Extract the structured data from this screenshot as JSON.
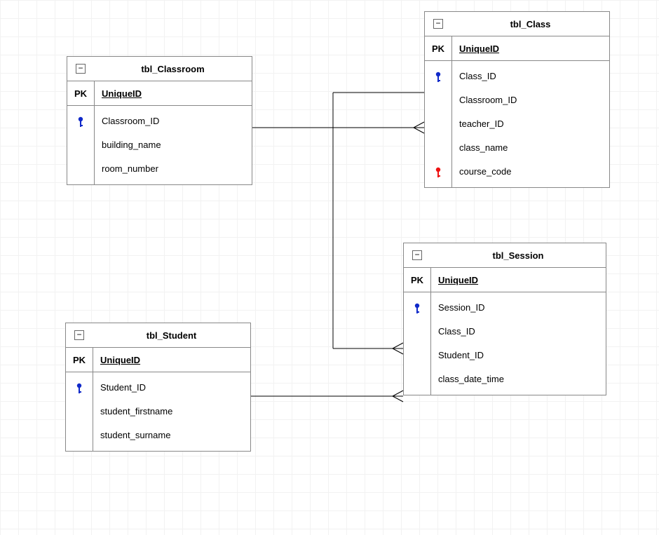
{
  "pk_label": "PK",
  "pk_name": "UniqueID",
  "entities": {
    "classroom": {
      "title": "tbl_Classroom",
      "attrs": [
        "Classroom_ID",
        "building_name",
        "room_number"
      ],
      "keys": [
        {
          "slot": 0,
          "color": "blue"
        }
      ]
    },
    "class": {
      "title": "tbl_Class",
      "attrs": [
        "Class_ID",
        "Classroom_ID",
        "teacher_ID",
        "class_name",
        "course_code"
      ],
      "keys": [
        {
          "slot": 0,
          "color": "blue"
        },
        {
          "slot": 4,
          "color": "red"
        }
      ]
    },
    "student": {
      "title": "tbl_Student",
      "attrs": [
        "Student_ID",
        "student_firstname",
        "student_surname"
      ],
      "keys": [
        {
          "slot": 0,
          "color": "blue"
        }
      ]
    },
    "session": {
      "title": "tbl_Session",
      "attrs": [
        "Session_ID",
        "Class_ID",
        "Student_ID",
        "class_date_time"
      ],
      "keys": [
        {
          "slot": 0,
          "color": "blue"
        }
      ]
    }
  },
  "relationships": [
    {
      "from": "classroom",
      "to": "class",
      "type": "one-to-many"
    },
    {
      "from": "student",
      "to": "session",
      "type": "one-to-many"
    },
    {
      "from": "class",
      "to": "session",
      "type": "one-to-many"
    }
  ]
}
